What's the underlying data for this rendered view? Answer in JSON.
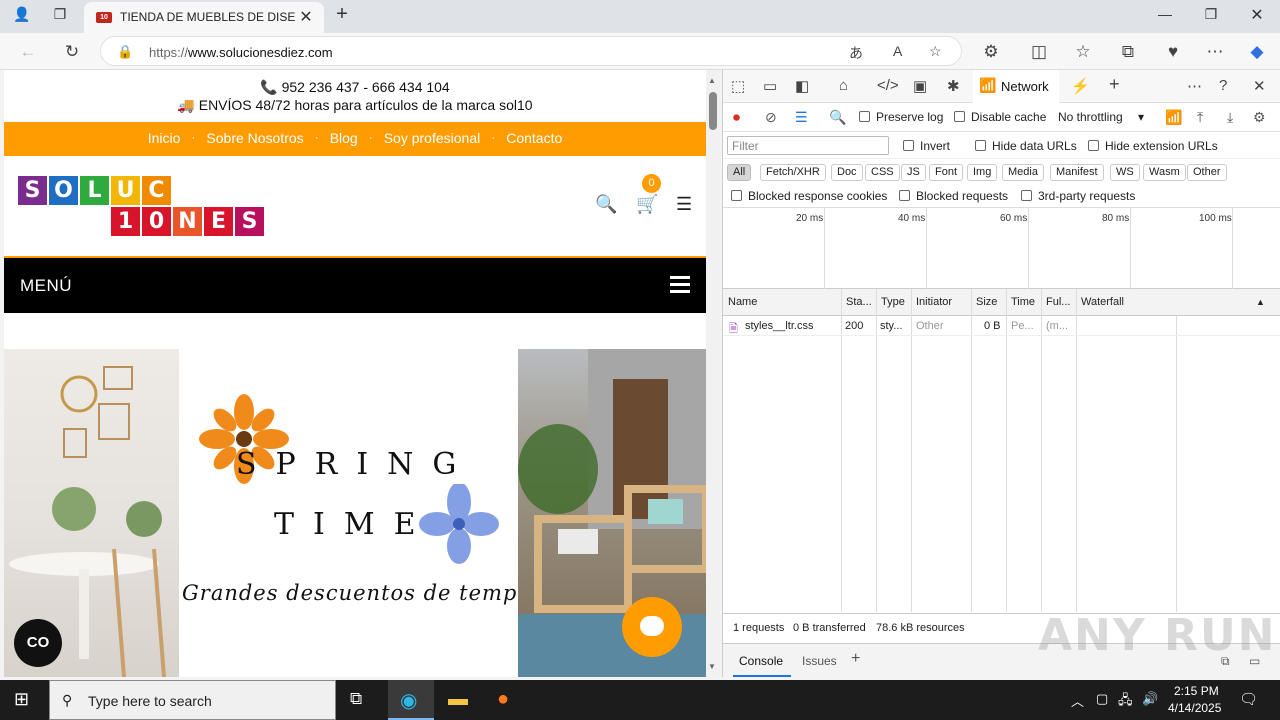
{
  "browser": {
    "tab_title": "TIENDA DE MUEBLES DE DISEÑO",
    "tab_favicon_text": "10",
    "url_prefix": "https://",
    "url_host": "www.solucionesdiez.com"
  },
  "site": {
    "phone": "📞 952 236 437 - 666 434 104",
    "shipping": "🚚 ENVÍOS 48/72 horas para artículos de la marca sol10",
    "nav": [
      "Inicio",
      "Sobre Nosotros",
      "Blog",
      "Soy profesional",
      "Contacto"
    ],
    "logo_row1": [
      "S",
      "O",
      "L",
      "U",
      "C"
    ],
    "logo_row2": [
      "1",
      "0",
      "N",
      "E",
      "S"
    ],
    "cart_count": "0",
    "menu_label": "MENÚ",
    "banner_line1": "SPRING",
    "banner_line2": "TIME",
    "banner_script": "Grandes descuentos de temporada",
    "a11y_label": "CO"
  },
  "devtools": {
    "network_tab": "Network",
    "preserve_log": "Preserve log",
    "disable_cache": "Disable cache",
    "throttling": "No throttling",
    "filter_placeholder": "Filter",
    "invert": "Invert",
    "hide_data_urls": "Hide data URLs",
    "hide_ext_urls": "Hide extension URLs",
    "type_filters": [
      "All",
      "Fetch/XHR",
      "Doc",
      "CSS",
      "JS",
      "Font",
      "Img",
      "Media",
      "Manifest",
      "WS",
      "Wasm",
      "Other"
    ],
    "blocked_cookies": "Blocked response cookies",
    "blocked_requests": "Blocked requests",
    "third_party": "3rd-party requests",
    "timeline_ticks": [
      "20 ms",
      "40 ms",
      "60 ms",
      "80 ms",
      "100 ms"
    ],
    "columns": [
      "Name",
      "Sta...",
      "Type",
      "Initiator",
      "Size",
      "Time",
      "Ful...",
      "Waterfall"
    ],
    "rows": [
      {
        "name": "styles__ltr.css",
        "status": "200",
        "type": "sty...",
        "initiator": "Other",
        "size": "0 B",
        "time": "Pe...",
        "fulfilled": "(m..."
      }
    ],
    "status_requests": "1 requests",
    "status_transferred": "0 B transferred",
    "status_resources": "78.6 kB resources",
    "drawer_console": "Console",
    "drawer_issues": "Issues"
  },
  "taskbar": {
    "search_placeholder": "Type here to search",
    "time": "2:15 PM",
    "date": "4/14/2025"
  },
  "watermark": "ANY RUN"
}
